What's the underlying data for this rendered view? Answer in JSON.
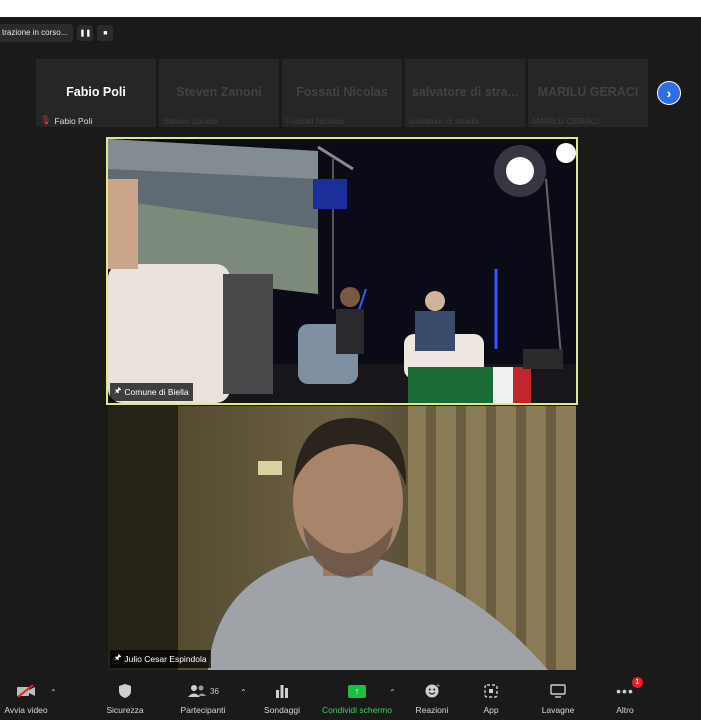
{
  "recording": {
    "status_text": "trazione in corso...",
    "pause_icon": "pause-icon",
    "stop_icon": "stop-icon"
  },
  "gallery": {
    "tiles": [
      {
        "name": "Fabio Poli",
        "sub": "Fabio Poli",
        "muted": true
      },
      {
        "name": "Steven Zanoni",
        "sub": "Steven Zanoni",
        "muted": false
      },
      {
        "name": "Fossati Nicolas",
        "sub": "Fossati Nicolas",
        "muted": false
      },
      {
        "name": "salvatore di stra...",
        "sub": "salvatore di strada",
        "muted": false
      },
      {
        "name": "MARILU GERACI",
        "sub": "MARILU GERACI",
        "muted": false
      }
    ],
    "next_icon": "chevron-right-icon"
  },
  "videos": [
    {
      "name": "Comune di Biella",
      "icon": "pin-icon"
    },
    {
      "name": "Julio Cesar Espindola",
      "icon": "pin-icon"
    }
  ],
  "toolbar": {
    "video": {
      "label": "Avvia video",
      "icon": "video-off-icon"
    },
    "security": {
      "label": "Sicurezza",
      "icon": "shield-icon"
    },
    "participants": {
      "label": "Partecipanti",
      "icon": "people-icon",
      "count": "36"
    },
    "polls": {
      "label": "Sondaggi",
      "icon": "bar-chart-icon"
    },
    "share": {
      "label": "Condividi schermo",
      "icon": "share-screen-icon"
    },
    "reactions": {
      "label": "Reazioni",
      "icon": "smiley-icon"
    },
    "apps": {
      "label": "App",
      "icon": "apps-icon"
    },
    "whiteboards": {
      "label": "Lavagne",
      "icon": "whiteboard-icon"
    },
    "more": {
      "label": "Altro",
      "icon": "more-icon",
      "badge": "1"
    }
  },
  "colors": {
    "background": "#1a1a1a",
    "active_speaker_border": "#e1e88a",
    "share_green": "#1cbf45",
    "next_button": "#2d6fe6",
    "alert_red": "#e02424"
  }
}
